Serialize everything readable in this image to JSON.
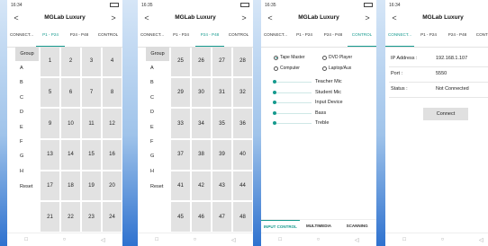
{
  "app_title": "MGLab Luxury",
  "nav": {
    "prev": "<",
    "next": ">"
  },
  "status_times": [
    "16:34",
    "16:35",
    "16:35",
    "16:34"
  ],
  "tabs": [
    "CONNECT...",
    "P1 - P24",
    "P24 - P48",
    "CONTROL"
  ],
  "tab_state": {
    "p1": 1,
    "p2": 2,
    "control": 3,
    "connect": 0
  },
  "groups": {
    "header": "Group",
    "letters": [
      "A",
      "B",
      "C",
      "D",
      "E",
      "F",
      "G",
      "H"
    ],
    "reset": "Reset"
  },
  "grid_p1": [
    [
      "1",
      "2",
      "3",
      "4"
    ],
    [
      "5",
      "6",
      "7",
      "8"
    ],
    [
      "9",
      "10",
      "11",
      "12"
    ],
    [
      "13",
      "14",
      "15",
      "16"
    ],
    [
      "17",
      "18",
      "19",
      "20"
    ],
    [
      "21",
      "22",
      "23",
      "24"
    ]
  ],
  "grid_p2": [
    [
      "25",
      "26",
      "27",
      "28"
    ],
    [
      "29",
      "30",
      "31",
      "32"
    ],
    [
      "33",
      "34",
      "35",
      "36"
    ],
    [
      "37",
      "38",
      "39",
      "40"
    ],
    [
      "41",
      "42",
      "43",
      "44"
    ],
    [
      "45",
      "46",
      "47",
      "48"
    ]
  ],
  "control": {
    "radios": [
      {
        "label": "Tape Master",
        "selected": true
      },
      {
        "label": "DVD Player",
        "selected": false
      },
      {
        "label": "Computer",
        "selected": false
      },
      {
        "label": "Laptop/Aux",
        "selected": false
      }
    ],
    "sliders": [
      {
        "label": "Teacher Mic",
        "value": 0
      },
      {
        "label": "Student Mic",
        "value": 0
      },
      {
        "label": "Input Device",
        "value": 0
      },
      {
        "label": "Bass",
        "value": 0
      },
      {
        "label": "Treble",
        "value": 0
      }
    ],
    "bottom_tabs": [
      "INPUT CONTROL",
      "MULTIMEDIA",
      "SCANNING"
    ]
  },
  "connect": {
    "ip_label": "IP Address :",
    "ip_value": "192.168.1.107",
    "port_label": "Port :",
    "port_value": "5550",
    "status_label": "Status :",
    "status_value": "Not Connected",
    "button": "Connect"
  },
  "colors": {
    "accent": "#169a8e",
    "cell": "#e2e2e2",
    "wallpaper": "#2f72cf"
  }
}
